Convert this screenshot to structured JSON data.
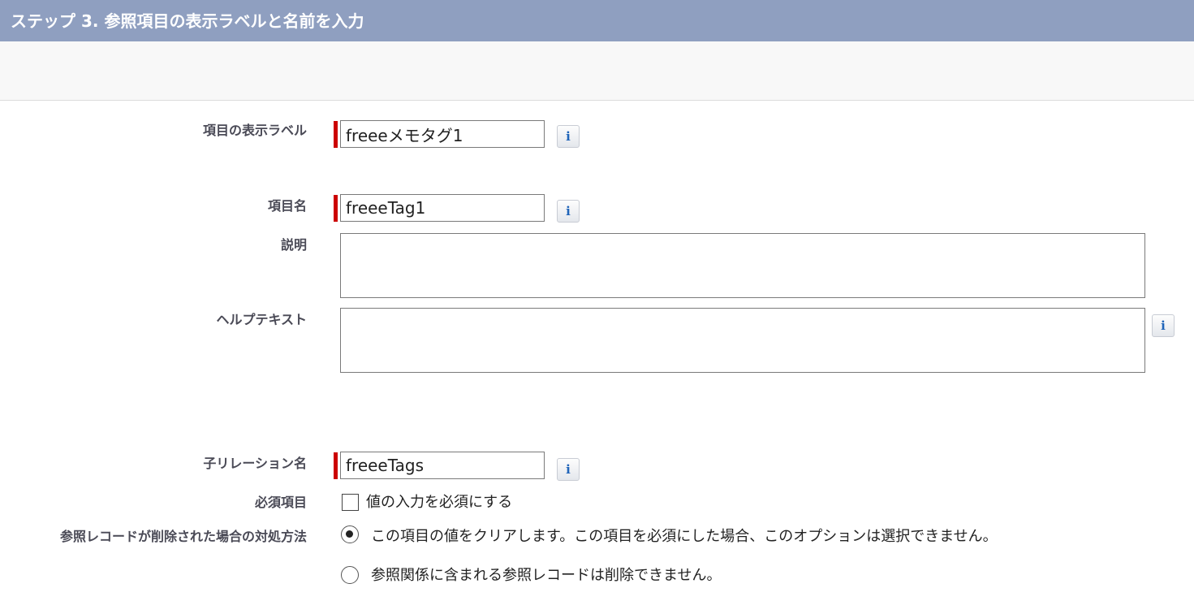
{
  "header": {
    "title": "ステップ 3. 参照項目の表示ラベルと名前を入力"
  },
  "form": {
    "field_label": {
      "label": "項目の表示ラベル",
      "value": "freeeメモタグ1"
    },
    "field_name": {
      "label": "項目名",
      "value": "freeeTag1"
    },
    "description": {
      "label": "説明",
      "value": ""
    },
    "help_text": {
      "label": "ヘルプテキスト",
      "value": ""
    },
    "child_relationship": {
      "label": "子リレーション名",
      "value": "freeeTags"
    },
    "required": {
      "label": "必須項目",
      "checkbox_label": "値の入力を必須にする",
      "checked": false
    },
    "on_delete": {
      "label": "参照レコードが削除された場合の対処方法",
      "options": [
        {
          "label": "この項目の値をクリアします。この項目を必須にした場合、このオプションは選択できません。",
          "selected": true
        },
        {
          "label": "参照関係に含まれる参照レコードは削除できません。",
          "selected": false
        }
      ]
    },
    "info_icon": "i"
  },
  "colors": {
    "header_bg": "#8f9fc0",
    "required_marker": "#cc0000",
    "info_glyph": "#1f64b9"
  }
}
